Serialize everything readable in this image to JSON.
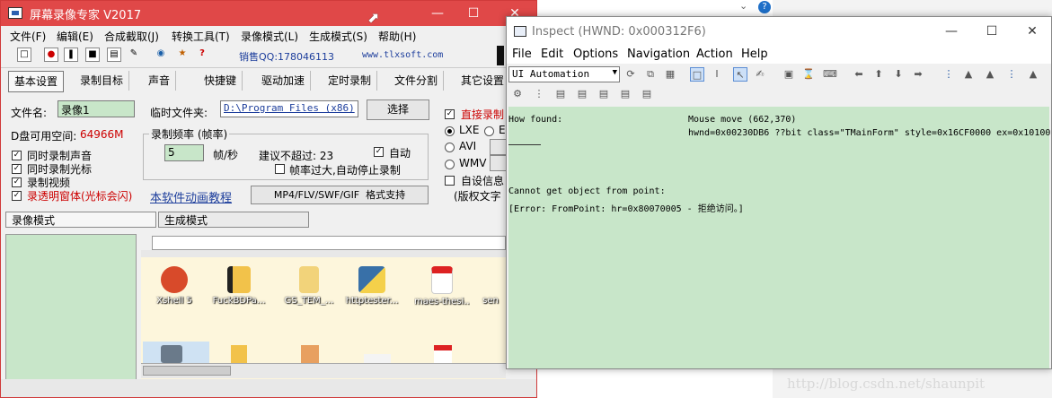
{
  "background": {
    "watermark": "http://blog.csdn.net/shaunpit"
  },
  "recorder": {
    "title": "屏幕录像专家 V2017",
    "menu": [
      "文件(F)",
      "编辑(E)",
      "合成截取(J)",
      "转换工具(T)",
      "录像模式(L)",
      "生成模式(S)",
      "帮助(H)"
    ],
    "toolbar": {
      "sales_qq": "销售QQ:178046113",
      "website": "www.tlxsoft.com"
    },
    "tabs": [
      "基本设置",
      "录制目标",
      "声音",
      "快捷键",
      "驱动加速",
      "定时录制",
      "文件分割",
      "其它设置"
    ],
    "file_name_label": "文件名:",
    "file_name_value": "录像1",
    "temp_folder_label": "临时文件夹:",
    "temp_folder_value": "D:\\Program Files (x86)",
    "select_button": "选择",
    "disk_space_label": "D盘可用空间:",
    "disk_space_value": "64966M",
    "checks": [
      "同时录制声音",
      "同时录制光标",
      "录制视频",
      "录透明窗体(光标会闪)"
    ],
    "frame_group_title": "录制频率 (帧率)",
    "fps_value": "5",
    "fps_unit": "帧/秒",
    "suggest": "建议不超过: 23",
    "auto_label": "自动",
    "auto_stop": "帧率过大,自动停止录制",
    "tutorial_link": "本软件动画教程",
    "format_button": "MP4/FLV/SWF/GIF  格式支持",
    "direct_record": "直接录制",
    "format_options": [
      "LXE",
      "AVI",
      "WMV"
    ],
    "format_option_e": "E",
    "custom_info": "自设信息",
    "copyright_text": "(版权文字",
    "mode_tabs": [
      "录像模式",
      "生成模式"
    ],
    "desktop_icons": [
      "Xshell 5",
      "FuckBDPa...",
      "GS_TEM_...",
      "httptester...",
      "maes-thesi...",
      "sen"
    ]
  },
  "inspect": {
    "title": "Inspect  (HWND: 0x000312F6)",
    "menu": [
      "File",
      "Edit",
      "Options",
      "Navigation",
      "Action",
      "Help"
    ],
    "mode": "UI Automation",
    "output": {
      "how_found_label": "How found:",
      "how_found_value": "Mouse move (662,370)",
      "hwnd_line": "hwnd=0x00230DB6 ??bit class=\"TMainForm\" style=0x16CF0000 ex=0x10100",
      "error_title": "Cannot get object from point:",
      "error_detail": "[Error: FromPoint: hr=0x80070005 - 拒绝访问。]"
    }
  }
}
